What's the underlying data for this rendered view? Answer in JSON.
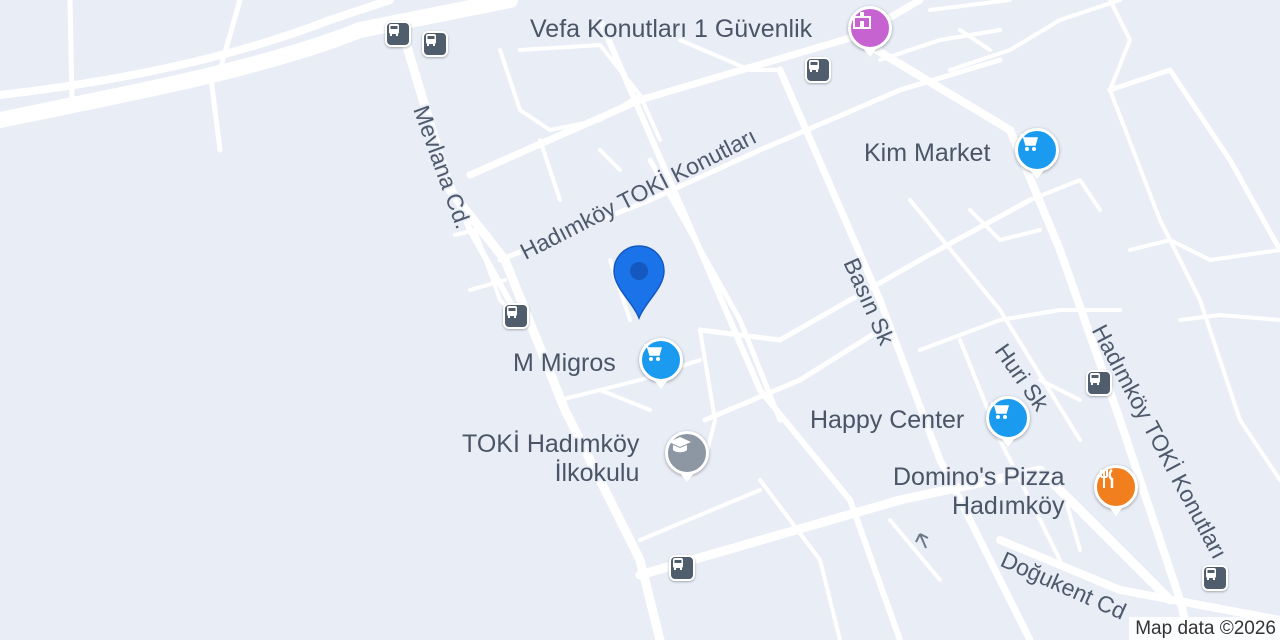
{
  "map": {
    "attribution": "Map data ©2026",
    "colors": {
      "land": "#e9edf6",
      "road": "#ffffff",
      "text": "#4a5566",
      "shopping": "#1a9bf0",
      "education": "#8d96a3",
      "food": "#f27f1e",
      "civic": "#c763d1",
      "transit": "#505d6d",
      "location": "#1a73e8"
    },
    "pois": {
      "vefa": "Vefa Konutları 1 Güvenlik",
      "kim_market": "Kim Market",
      "m_migros": "M Migros",
      "toki_school_line1": "TOKİ Hadımköy",
      "toki_school_line2": "İlkokulu",
      "happy_center": "Happy Center",
      "dominos_line1": "Domino's Pizza",
      "dominos_line2": "Hadımköy"
    },
    "roads": {
      "mevlana": "Mevlana Cd.",
      "toki_konutlari_1": "Hadımköy TOKİ Konutları",
      "basin": "Basın Sk",
      "huri": "Huri Sk",
      "toki_konutlari_2": "Hadımköy TOKİ Konutları",
      "dogukent": "Doğukent Cd"
    },
    "icons": {
      "shopping": "shopping-cart-icon",
      "education": "graduation-cap-icon",
      "food": "fork-knife-icon",
      "civic": "government-building-icon",
      "transit": "bus-icon",
      "location": "location-pin-icon"
    }
  }
}
